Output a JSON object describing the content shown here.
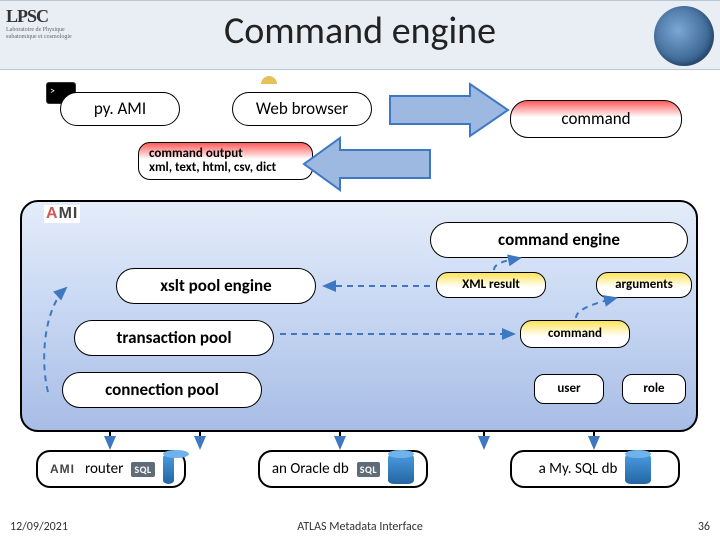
{
  "header": {
    "title": "Command engine",
    "logo_text": "LPSC",
    "logo_sub": "Laboratoire de Physique\nsubatomique et cosmologie"
  },
  "clients": {
    "pyami": "py. AMI",
    "web": "Web browser",
    "command_in": "command",
    "output": "command output\nxml, text, html, csv, dict"
  },
  "engine": {
    "ami_brand": "AMI",
    "cmd_engine": "command engine",
    "xslt": "xslt pool engine",
    "xml_result": "XML result",
    "arguments": "arguments",
    "transaction": "transaction pool",
    "command": "command",
    "connection": "connection pool",
    "user": "user",
    "role": "role"
  },
  "db": {
    "router": "router",
    "oracle": "an Oracle db",
    "mysql": "a My. SQL db",
    "sql": "SQL"
  },
  "footer": {
    "date": "12/09/2021",
    "center": "ATLAS Metadata Interface",
    "page": "36"
  },
  "colors": {
    "arrow_blue": "#3f78c2",
    "arrow_blue_fill": "#9db9e2"
  }
}
